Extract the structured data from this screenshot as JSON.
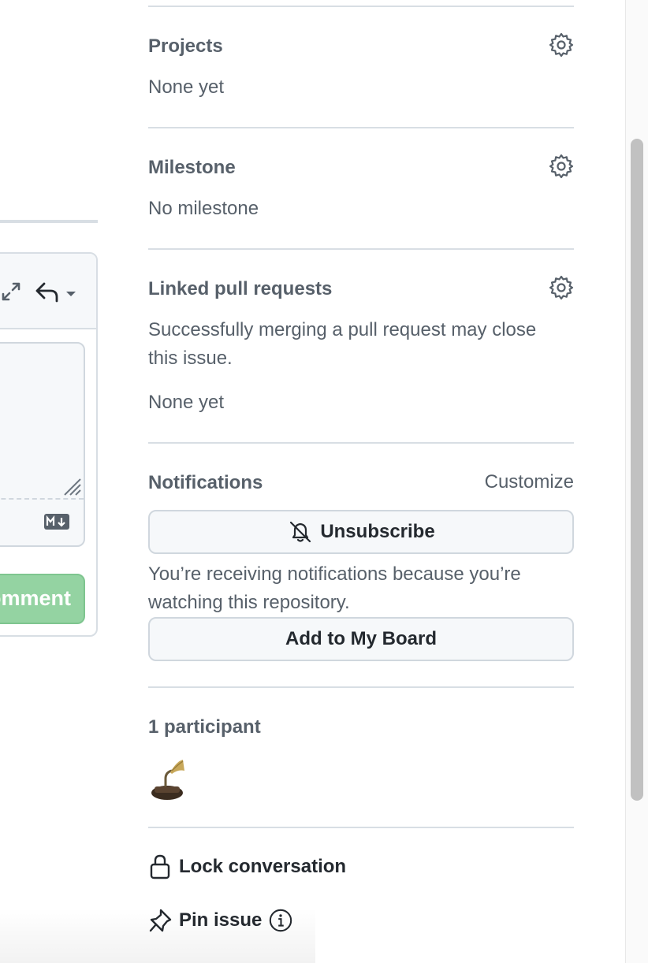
{
  "composer": {
    "comment_button_label": "Comment",
    "expand_icon": "expand-icon",
    "reply_icon": "reply-icon",
    "markdown_icon": "markdown-icon"
  },
  "sidebar": {
    "projects": {
      "heading": "Projects",
      "value": "None yet",
      "icon": "gear-icon"
    },
    "milestone": {
      "heading": "Milestone",
      "value": "No milestone",
      "icon": "gear-icon"
    },
    "linked_pull_requests": {
      "heading": "Linked pull requests",
      "description_line1": "Successfully merging a pull request may close",
      "description_line2": "this issue.",
      "value": "None yet",
      "icon": "gear-icon"
    },
    "notifications": {
      "heading": "Notifications",
      "customize_label": "Customize",
      "unsubscribe_label": "Unsubscribe",
      "unsubscribe_icon": "bell-slash-icon",
      "reason_line1": "You’re receiving notifications because you’re",
      "reason_line2": "watching this repository.",
      "add_board_label": "Add to My Board"
    },
    "participants": {
      "heading": "1 participant",
      "avatar_icon": "gramophone-avatar"
    },
    "actions": {
      "lock_label": "Lock conversation",
      "lock_icon": "lock-icon",
      "pin_label": "Pin issue",
      "pin_icon": "pin-icon",
      "info_icon": "info-icon"
    }
  },
  "colors": {
    "accent_button": "#94d3a2",
    "muted_text": "#57606a",
    "border": "#d8dee4",
    "scroll_thumb": "#c1c1c1"
  }
}
